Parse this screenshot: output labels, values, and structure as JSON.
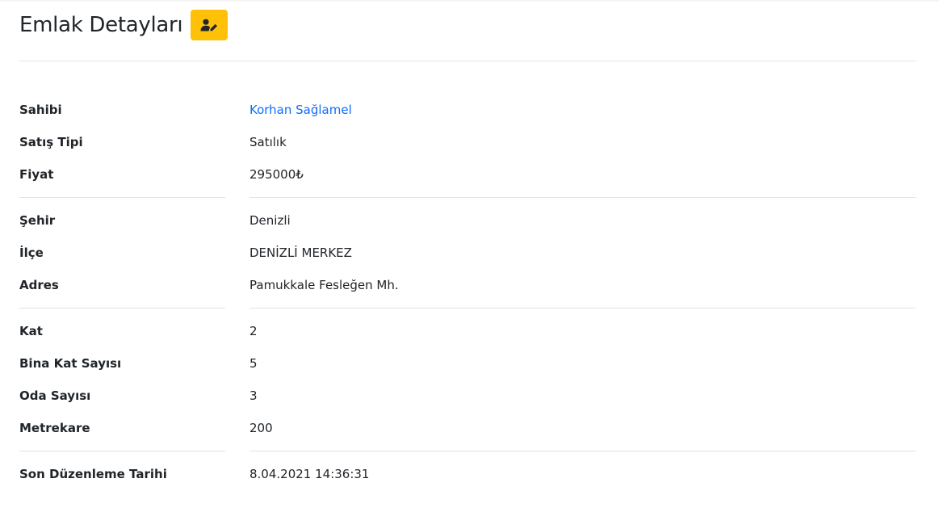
{
  "header": {
    "title": "Emlak Detayları",
    "edit_icon": "user-edit-icon"
  },
  "details": {
    "owner": {
      "label": "Sahibi",
      "value": "Korhan Sağlamel"
    },
    "sale_type": {
      "label": "Satış Tipi",
      "value": "Satılık"
    },
    "price": {
      "label": "Fiyat",
      "value": "295000₺"
    },
    "city": {
      "label": "Şehir",
      "value": "Denizli"
    },
    "district": {
      "label": "İlçe",
      "value": "DENİZLİ MERKEZ"
    },
    "address": {
      "label": "Adres",
      "value": "Pamukkale Fesleğen Mh."
    },
    "floor": {
      "label": "Kat",
      "value": "2"
    },
    "building_floors": {
      "label": "Bina Kat Sayısı",
      "value": "5"
    },
    "room_count": {
      "label": "Oda Sayısı",
      "value": "3"
    },
    "square_meters": {
      "label": "Metrekare",
      "value": "200"
    },
    "last_edit": {
      "label": "Son Düzenleme Tarihi",
      "value": "8.04.2021 14:36:31"
    }
  },
  "colors": {
    "accent": "#ffc107",
    "link": "#0d6efd",
    "divider": "#e3e3e3"
  }
}
